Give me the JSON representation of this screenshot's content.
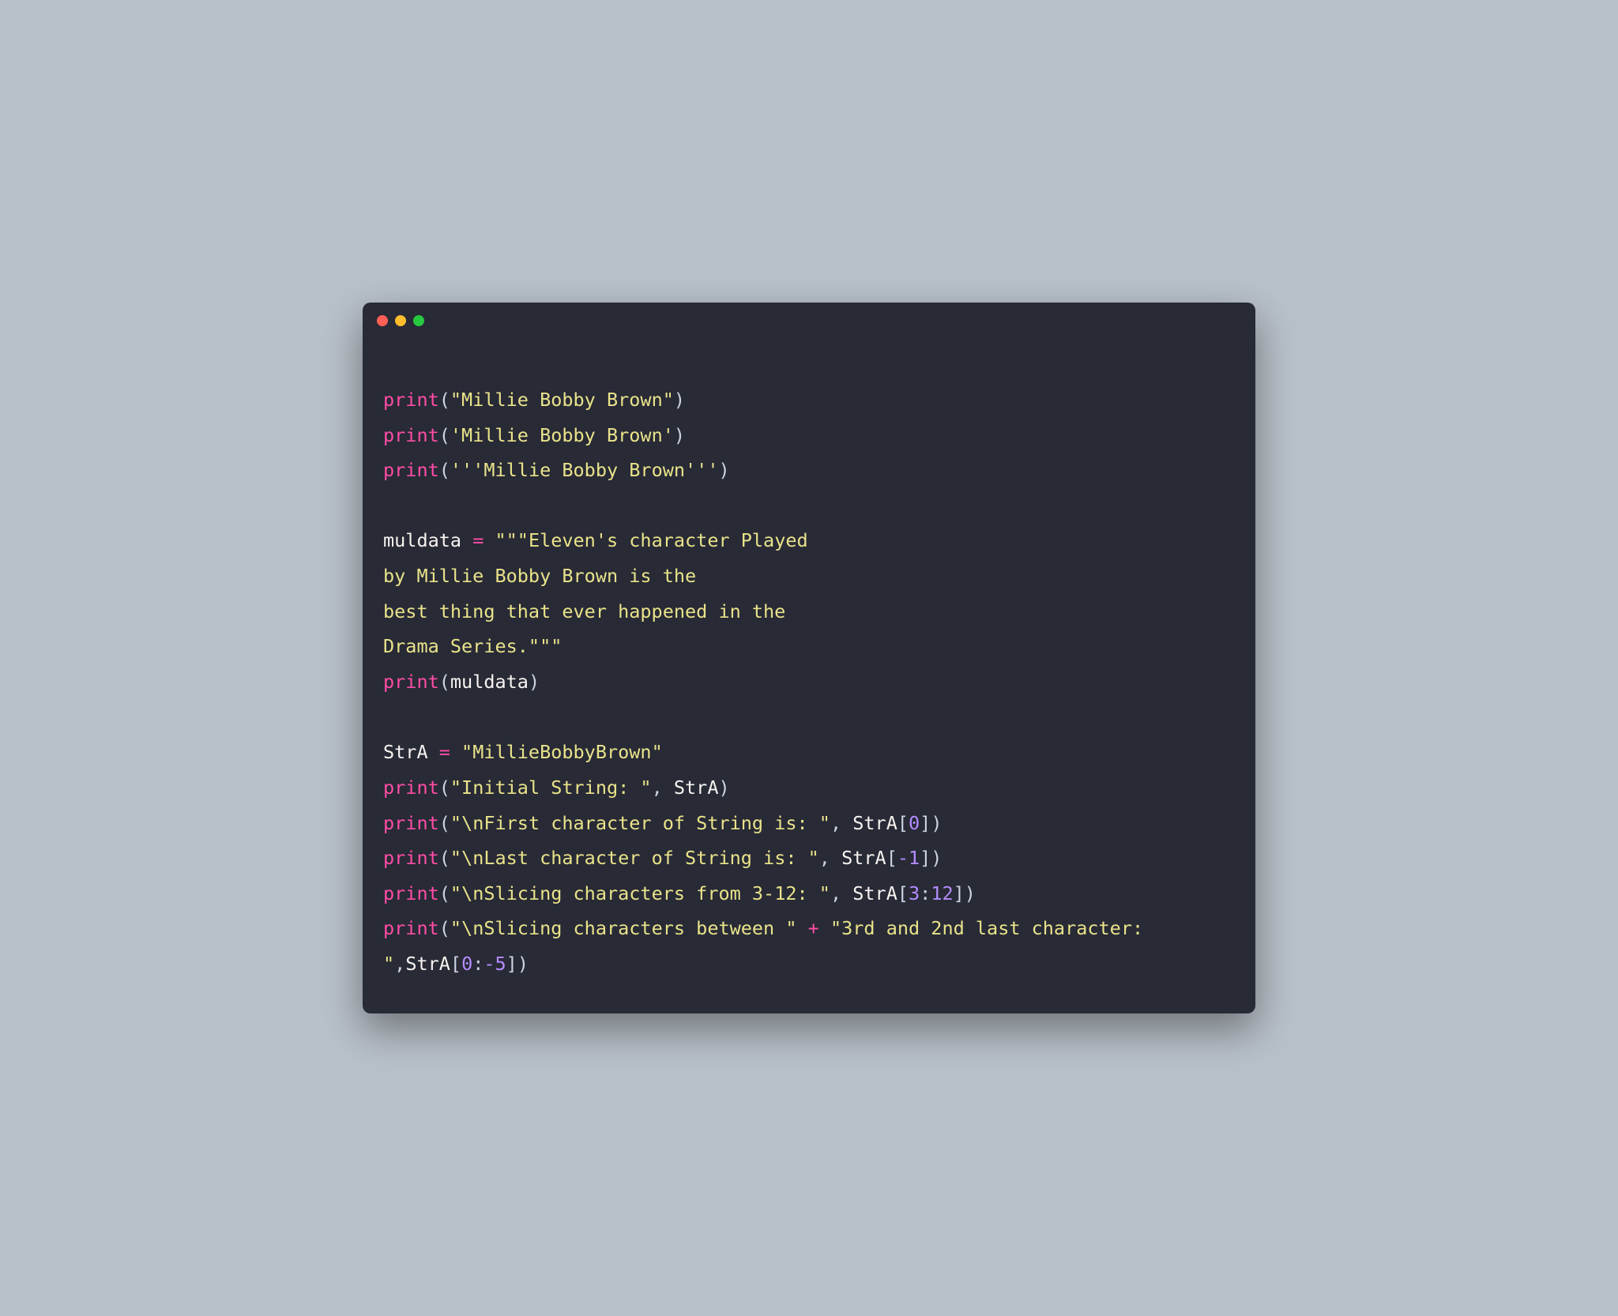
{
  "tokens": {
    "print": "print",
    "lp": "(",
    "rp": ")",
    "lb": "[",
    "rb": "]",
    "colon": ":",
    "eq": " = ",
    "plus": " + ",
    "comma_sp": ", ",
    "comma": ",",
    "muldata": "muldata",
    "stra": "StrA",
    "n0": "0",
    "n3": "3",
    "n12": "12",
    "nm1": "-1",
    "nm5": "-5"
  },
  "strings": {
    "s1": "\"Millie Bobby Brown\"",
    "s2": "'Millie Bobby Brown'",
    "s3": "'''Millie Bobby Brown'''",
    "mul_open": "\"\"\"Eleven's character Played",
    "mul_l2": "by Millie Bobby Brown is the",
    "mul_l3": "best thing that ever happened in the",
    "mul_close": "Drama Series.\"\"\"",
    "straval": "\"MillieBobbyBrown\"",
    "init": "\"Initial String: \"",
    "first": "\"\\nFirst character of String is: \"",
    "last": "\"\\nLast character of String is: \"",
    "slice312": "\"\\nSlicing characters from 3-12: \"",
    "slicebet": "\"\\nSlicing characters between \"",
    "thirdsec": "\"3rd and 2nd last character: ",
    "closeq": "\""
  }
}
